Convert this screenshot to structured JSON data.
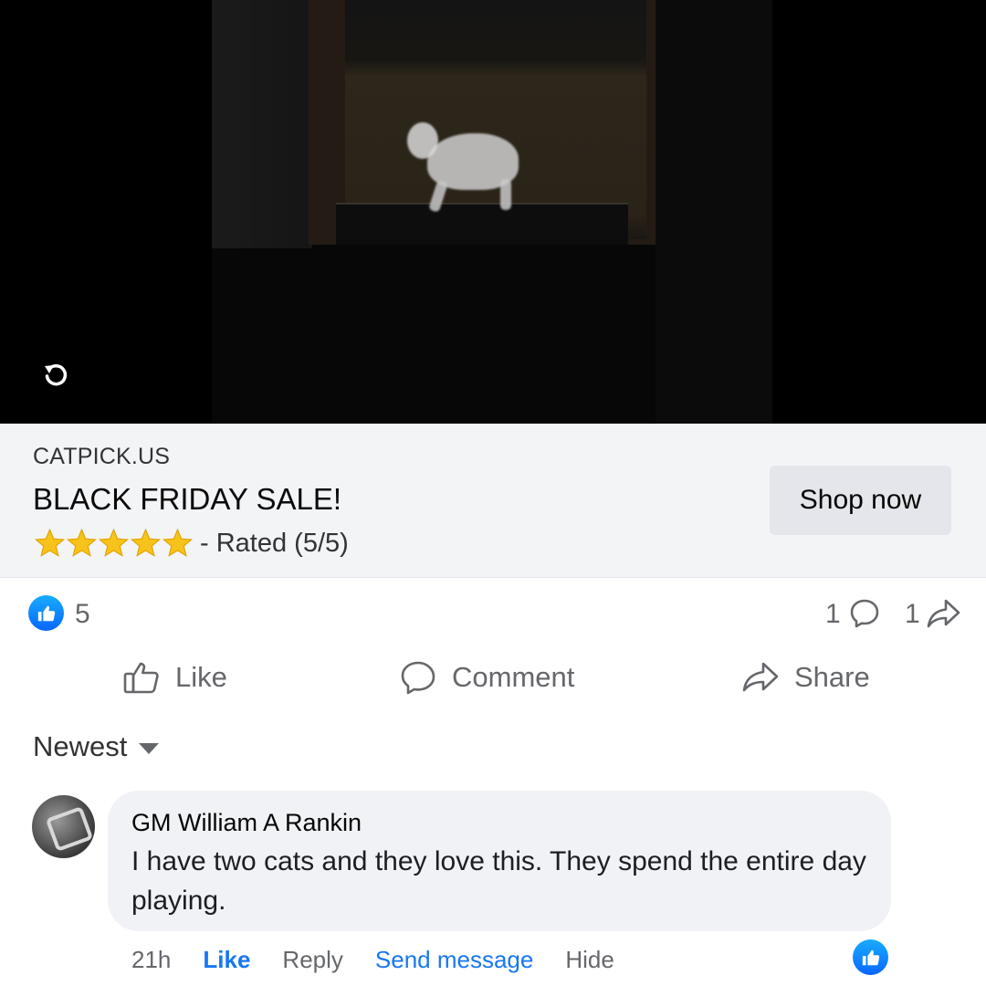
{
  "ad": {
    "domain": "CATPICK.US",
    "headline": "BLACK FRIDAY SALE!",
    "rating_text": "- Rated (5/5)",
    "rating_stars": 5,
    "cta_label": "Shop now"
  },
  "counts": {
    "likes": "5",
    "comments": "1",
    "shares": "1"
  },
  "actions": {
    "like": "Like",
    "comment": "Comment",
    "share": "Share"
  },
  "sort": {
    "label": "Newest"
  },
  "comment": {
    "author": "GM William A Rankin",
    "text": "I have two cats and they love this. They spend the entire day playing.",
    "time": "21h",
    "like": "Like",
    "reply": "Reply",
    "send_message": "Send message",
    "hide": "Hide"
  },
  "colors": {
    "facebook_blue": "#1877f2",
    "star_yellow": "#f7c21a",
    "muted_text": "#65676b"
  }
}
